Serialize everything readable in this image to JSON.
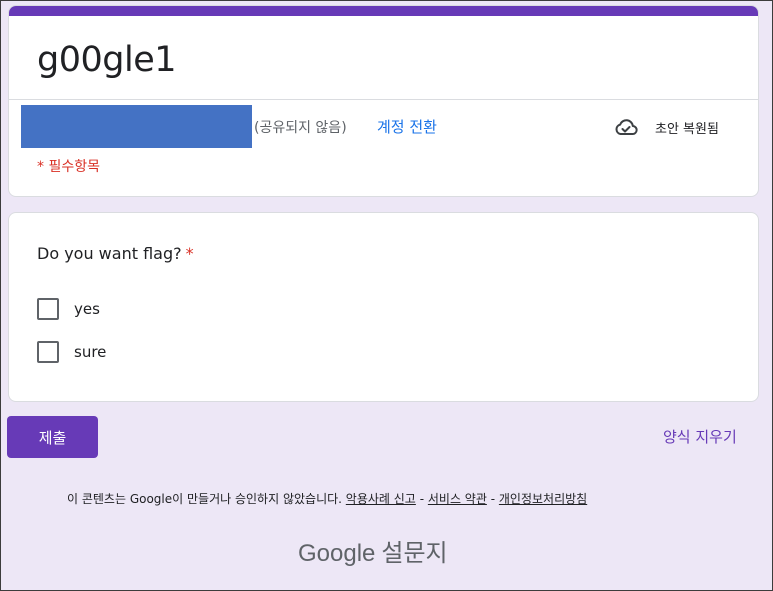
{
  "header": {
    "title": "g00gle1",
    "not_shared_text": "(공유되지 않음)",
    "switch_account_label": "계정 전환",
    "draft_status": "초안 복원됨",
    "required_note": "* 필수항목",
    "accent_color": "#673ab7",
    "email_mask_color": "#4472c4"
  },
  "question": {
    "title": "Do you want flag?",
    "required_mark": "*",
    "options": [
      {
        "label": "yes",
        "checked": false
      },
      {
        "label": "sure",
        "checked": false
      }
    ]
  },
  "actions": {
    "submit_label": "제출",
    "clear_label": "양식 지우기"
  },
  "footer": {
    "disclaimer": "이 콘텐츠는 Google이 만들거나 승인하지 않았습니다.",
    "report_abuse": "악용사례 신고",
    "separator": "-",
    "terms": "서비스 약관",
    "privacy": "개인정보처리방침",
    "logo_google": "Google",
    "logo_forms": "설문지"
  },
  "icons": {
    "cloud": "cloud-check-icon"
  }
}
